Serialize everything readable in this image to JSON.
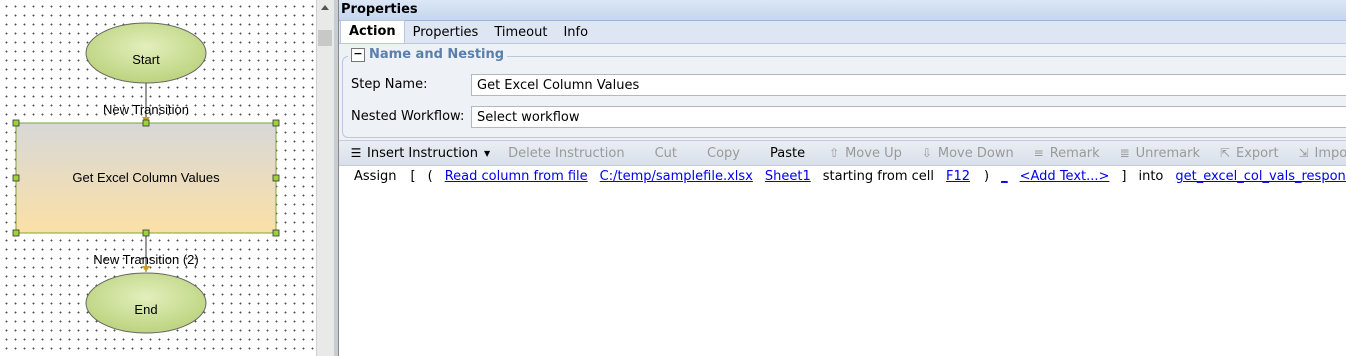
{
  "workflow": {
    "start_label": "Start",
    "transition1_label": "New Transition",
    "step_label": "Get Excel Column Values",
    "transition2_label": "New Transition (2)",
    "end_label": "End"
  },
  "panel": {
    "title": "Properties",
    "tabs": [
      "Action",
      "Properties",
      "Timeout",
      "Info"
    ],
    "active_tab": "Action",
    "section_title": "Name and Nesting",
    "step_name_label": "Step Name:",
    "step_name_value": "Get Excel Column Values",
    "nested_workflow_label": "Nested Workflow:",
    "nested_workflow_value": "Select workflow"
  },
  "toolbar": {
    "insert": "Insert Instruction",
    "delete": "Delete Instruction",
    "cut": "Cut",
    "copy": "Copy",
    "paste": "Paste",
    "move_up": "Move Up",
    "move_down": "Move Down",
    "remark": "Remark",
    "unremark": "Unremark",
    "export": "Export",
    "import": "Import"
  },
  "instruction": {
    "assign": "Assign",
    "open_bracket": "[",
    "open_paren": "(",
    "action": "Read column from file",
    "file": "C:/temp/samplefile.xlsx",
    "sheet": "Sheet1",
    "starting_text": "starting from cell",
    "cell": "F12",
    "close_paren": ")",
    "underscore": "_",
    "add_text": "<Add Text...>",
    "close_bracket": "]",
    "into": "into",
    "target": "get_excel_col_vals_response"
  },
  "colors": {
    "node_green": "#cfe0a0",
    "step_top": "#d8d8d8",
    "step_bottom": "#fbe0a6",
    "handle": "#9cd33c",
    "link": "#0000ee"
  }
}
